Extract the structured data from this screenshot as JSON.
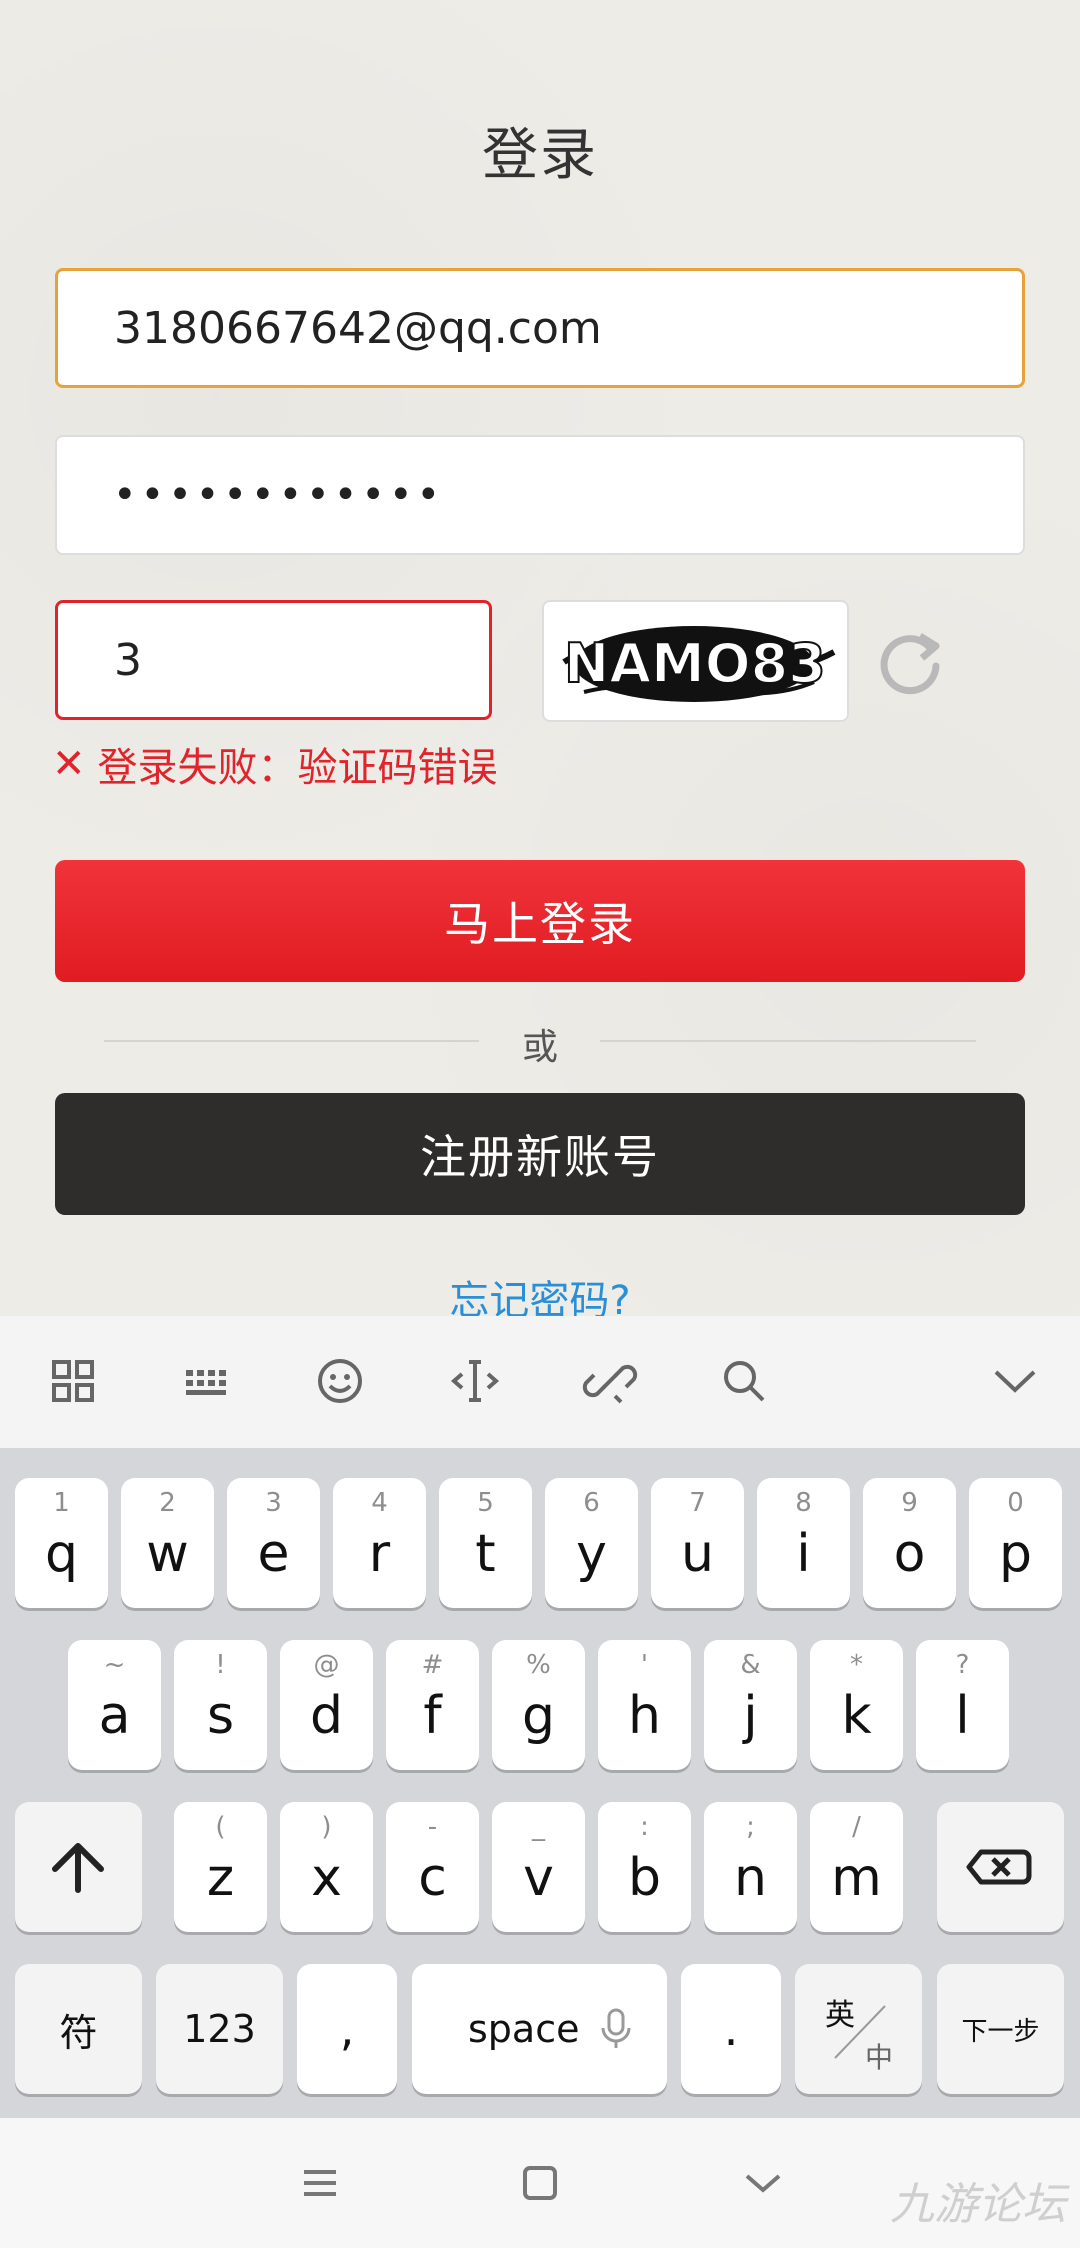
{
  "title": "登录",
  "form": {
    "email_value": "3180667642@qq.com",
    "password_mask": "••••••••••••",
    "captcha_value": "3",
    "captcha_text": "NAMO83",
    "error_text": "登录失败：验证码错误"
  },
  "buttons": {
    "login": "马上登录",
    "or": "或",
    "register": "注册新账号",
    "forgot": "忘记密码?"
  },
  "keyboard": {
    "row1": [
      [
        "q",
        "1"
      ],
      [
        "w",
        "2"
      ],
      [
        "e",
        "3"
      ],
      [
        "r",
        "4"
      ],
      [
        "t",
        "5"
      ],
      [
        "y",
        "6"
      ],
      [
        "u",
        "7"
      ],
      [
        "i",
        "8"
      ],
      [
        "o",
        "9"
      ],
      [
        "p",
        "0"
      ]
    ],
    "row2": [
      [
        "a",
        "~"
      ],
      [
        "s",
        "!"
      ],
      [
        "d",
        "@"
      ],
      [
        "f",
        "#"
      ],
      [
        "g",
        "%"
      ],
      [
        "h",
        "'"
      ],
      [
        "j",
        "&"
      ],
      [
        "k",
        "*"
      ],
      [
        "l",
        "?"
      ]
    ],
    "row3": [
      [
        "z",
        "("
      ],
      [
        "x",
        ")"
      ],
      [
        "c",
        "-"
      ],
      [
        "v",
        "_"
      ],
      [
        "b",
        ":"
      ],
      [
        "n",
        ";"
      ],
      [
        "m",
        "/"
      ]
    ],
    "symbol_key": "符",
    "num_key": "123",
    "comma_key": ",",
    "space_key": "space",
    "period_key": ".",
    "lang_top": "英",
    "lang_bottom": "中",
    "next_key": "下一步"
  },
  "watermark": "九游论坛"
}
